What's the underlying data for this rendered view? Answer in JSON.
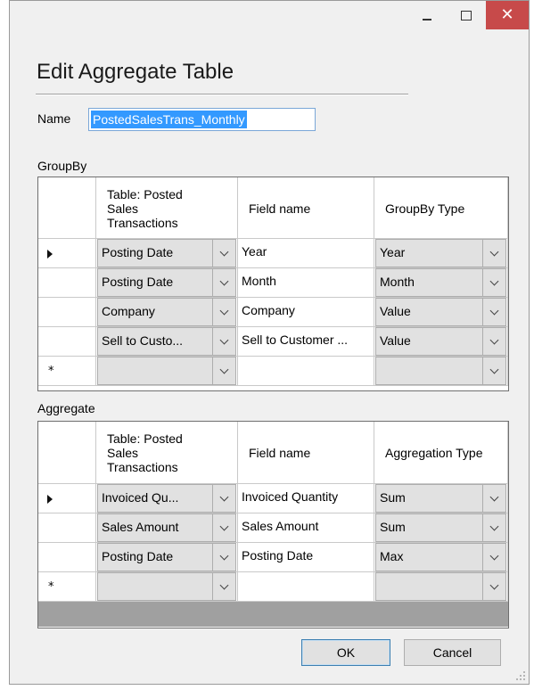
{
  "window": {
    "minimize_icon": "minimize-icon",
    "maximize_icon": "maximize-icon",
    "close_glyph": "✕",
    "close_color": "#c74a4a"
  },
  "dialog": {
    "title": "Edit Aggregate Table",
    "name_label": "Name",
    "name_value": "PostedSalesTrans_Monthly"
  },
  "groupby": {
    "label": "GroupBy",
    "headers": [
      "Table: Posted\nSales\nTransactions",
      "Field name",
      "GroupBy Type"
    ],
    "rows": [
      {
        "current": true,
        "table": "Posting Date",
        "field": "Year",
        "type": "Year"
      },
      {
        "current": false,
        "table": "Posting Date",
        "field": "Month",
        "type": "Month"
      },
      {
        "current": false,
        "table": "Company",
        "field": "Company",
        "type": "Value"
      },
      {
        "current": false,
        "table": "Sell to Custo...",
        "field": "Sell to Customer ...",
        "type": "Value"
      }
    ],
    "new_row_marker": "*"
  },
  "aggregate": {
    "label": "Aggregate",
    "headers": [
      "Table: Posted\nSales\nTransactions",
      "Field name",
      "Aggregation Type"
    ],
    "rows": [
      {
        "current": true,
        "table": "Invoiced Qu...",
        "field": "Invoiced Quantity",
        "type": "Sum"
      },
      {
        "current": false,
        "table": "Sales Amount",
        "field": "Sales Amount",
        "type": "Sum"
      },
      {
        "current": false,
        "table": "Posting Date",
        "field": "Posting Date",
        "type": "Max"
      }
    ],
    "new_row_marker": "*"
  },
  "buttons": {
    "ok": "OK",
    "cancel": "Cancel"
  }
}
